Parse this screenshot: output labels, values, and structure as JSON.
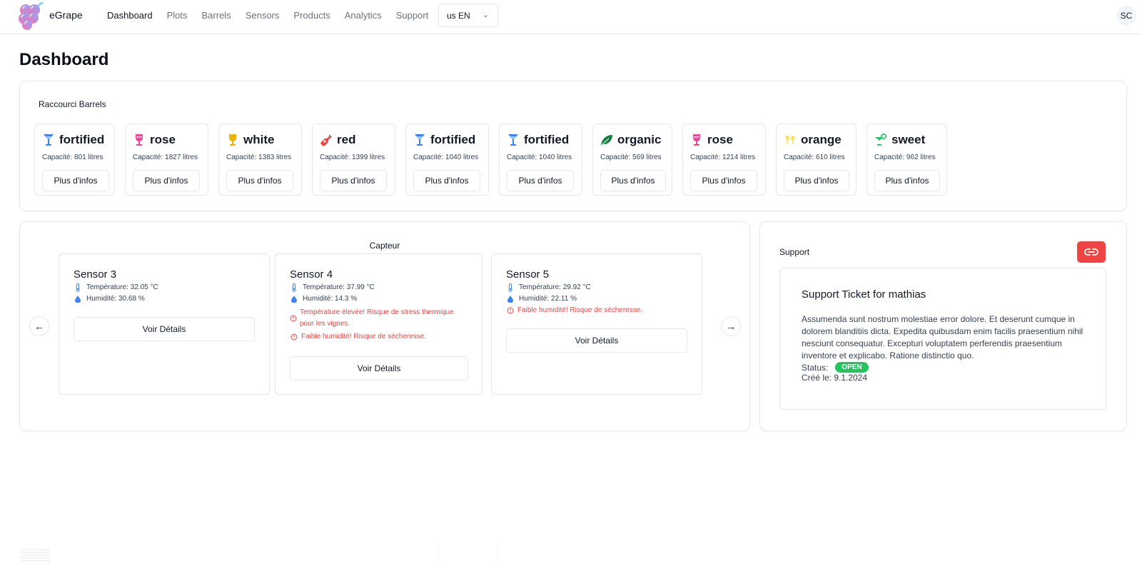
{
  "navbar": {
    "brand": "eGrape",
    "links": [
      {
        "label": "Dashboard",
        "active": true
      },
      {
        "label": "Plots",
        "active": false
      },
      {
        "label": "Barrels",
        "active": false
      },
      {
        "label": "Sensors",
        "active": false
      },
      {
        "label": "Products",
        "active": false
      },
      {
        "label": "Analytics",
        "active": false
      },
      {
        "label": "Support",
        "active": false
      }
    ],
    "language": "us EN",
    "avatar_initials": "SC"
  },
  "page_title": "Dashboard",
  "barrels": {
    "label": "Raccourci Barrels",
    "button_label": "Plus d'infos",
    "items": [
      {
        "type": "fortified",
        "icon": "cocktail-glass-icon",
        "color": "#3b82f6",
        "capacity": "Capacité: 801 litres"
      },
      {
        "type": "rose",
        "icon": "wine-glass-icon",
        "color": "#ec4899",
        "capacity": "Capacité: 1827 litres"
      },
      {
        "type": "white",
        "icon": "wine-glass-icon",
        "color": "#eab308",
        "capacity": "Capacité: 1383 litres"
      },
      {
        "type": "red",
        "icon": "wine-bottle-icon",
        "color": "#ef4444",
        "capacity": "Capacité: 1399 litres"
      },
      {
        "type": "fortified",
        "icon": "cocktail-glass-icon",
        "color": "#3b82f6",
        "capacity": "Capacité: 1040 litres"
      },
      {
        "type": "fortified",
        "icon": "cocktail-glass-icon",
        "color": "#3b82f6",
        "capacity": "Capacité: 1040 litres"
      },
      {
        "type": "organic",
        "icon": "leaf-icon",
        "color": "#15803d",
        "capacity": "Capacité: 569 litres"
      },
      {
        "type": "rose",
        "icon": "wine-glass-icon",
        "color": "#ec4899",
        "capacity": "Capacité: 1214 litres"
      },
      {
        "type": "orange",
        "icon": "glasses-cheers-icon",
        "color": "#fde047",
        "capacity": "Capacité: 610 litres"
      },
      {
        "type": "sweet",
        "icon": "martini-glass-citrus-icon",
        "color": "#22c55e",
        "capacity": "Capacité: 962 litres"
      }
    ]
  },
  "sensors": {
    "title": "Capteur",
    "button_label": "Voir Détails",
    "items": [
      {
        "name": "Sensor 3",
        "temperature": "Température: 32.05 °C",
        "humidity": "Humidité: 30.68 %",
        "warnings": []
      },
      {
        "name": "Sensor 4",
        "temperature": "Température: 37.99 °C",
        "humidity": "Humidité: 14.3 %",
        "warnings": [
          "Température élevée! Risque de stress thermique pour les vignes.",
          "Faible humidité! Risque de sécheresse."
        ]
      },
      {
        "name": "Sensor 5",
        "temperature": "Température: 29.92 °C",
        "humidity": "Humidité: 22.11 %",
        "warnings": [
          "Faible humidité! Risque de sécheresse."
        ]
      }
    ]
  },
  "support": {
    "label": "Support",
    "ticket": {
      "title": "Support Ticket for mathias",
      "body": "Assumenda sunt nostrum molestiae error dolore. Et deserunt cumque in dolorem blanditiis dicta. Expedita quibusdam enim facilis praesentium nihil nesciunt consequatur. Excepturi voluptatem perferendis praesentium inventore et explicabo. Ratione distinctio quo.",
      "status_label": "Status:",
      "status": "OPEN",
      "created_label": "Créé le: 9.1.2024"
    }
  },
  "colors": {
    "accent_red": "#ef4444",
    "status_open": "#22c55e",
    "warning": "#ef4444",
    "sensor_icon": "#3b82f6"
  }
}
